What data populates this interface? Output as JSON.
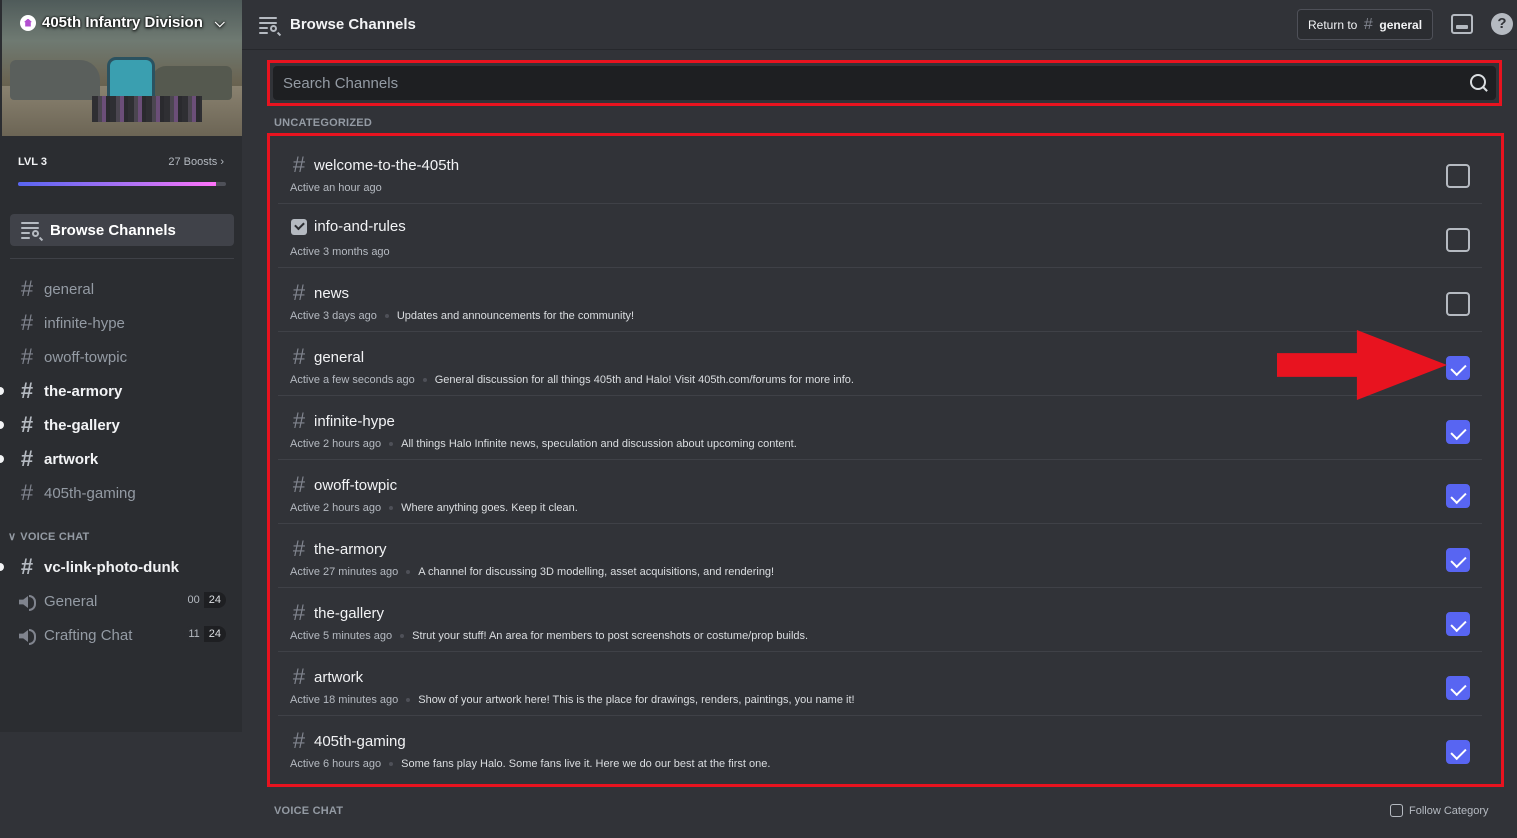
{
  "server": {
    "name": "405th Infantry Division",
    "level": "LVL 3",
    "boosts": "27 Boosts",
    "boost_progress": 0.95
  },
  "sidebar": {
    "browse_label": "Browse Channels",
    "channels": [
      {
        "name": "general",
        "unread": false
      },
      {
        "name": "infinite-hype",
        "unread": false
      },
      {
        "name": "owoff-towpic",
        "unread": false
      },
      {
        "name": "the-armory",
        "unread": true
      },
      {
        "name": "the-gallery",
        "unread": true
      },
      {
        "name": "artwork",
        "unread": true
      },
      {
        "name": "405th-gaming",
        "unread": false
      }
    ],
    "voice_category": "VOICE CHAT",
    "voice_text_channel": "vc-link-photo-dunk",
    "voice_channels": [
      {
        "name": "General",
        "count_a": "00",
        "count_b": "24"
      },
      {
        "name": "Crafting Chat",
        "count_a": "11",
        "count_b": "24"
      }
    ]
  },
  "header": {
    "title": "Browse Channels",
    "return_prefix": "Return to",
    "return_channel": "general",
    "help_glyph": "?"
  },
  "search": {
    "placeholder": "Search Channels",
    "value": ""
  },
  "categories": {
    "uncategorized": "UNCATEGORIZED",
    "voice": "VOICE CHAT",
    "follow_label": "Follow Category"
  },
  "channel_list": [
    {
      "name": "welcome-to-the-405th",
      "active": "Active an hour ago",
      "desc": "",
      "checked": false,
      "icon": "hash-icon"
    },
    {
      "name": "info-and-rules",
      "active": "Active 3 months ago",
      "desc": "",
      "checked": false,
      "icon": "rules-icon"
    },
    {
      "name": "news",
      "active": "Active 3 days ago",
      "desc": "Updates and announcements for the community!",
      "checked": false,
      "icon": "hash-icon"
    },
    {
      "name": "general",
      "active": "Active a few seconds ago",
      "desc": "General discussion for all things 405th and Halo! Visit 405th.com/forums for more info.",
      "checked": true,
      "icon": "hash-icon"
    },
    {
      "name": "infinite-hype",
      "active": "Active 2 hours ago",
      "desc": "All things Halo Infinite news, speculation and discussion about upcoming content.",
      "checked": true,
      "icon": "hash-icon"
    },
    {
      "name": "owoff-towpic",
      "active": "Active 2 hours ago",
      "desc": "Where anything goes. Keep it clean.",
      "checked": true,
      "icon": "hash-icon"
    },
    {
      "name": "the-armory",
      "active": "Active 27 minutes ago",
      "desc": "A channel for discussing 3D modelling, asset acquisitions, and rendering!",
      "checked": true,
      "icon": "hash-icon"
    },
    {
      "name": "the-gallery",
      "active": "Active 5 minutes ago",
      "desc": "Strut your stuff! An area for members to post screenshots or costume/prop builds.",
      "checked": true,
      "icon": "hash-icon"
    },
    {
      "name": "artwork",
      "active": "Active 18 minutes ago",
      "desc": "Show of your artwork here! This is the place for drawings, renders, paintings, you name it!",
      "checked": true,
      "icon": "hash-icon"
    },
    {
      "name": "405th-gaming",
      "active": "Active 6 hours ago",
      "desc": "Some fans play Halo. Some fans live it. Here we do our best at the first one.",
      "checked": true,
      "icon": "hash-icon"
    }
  ],
  "colors": {
    "accent": "#5865f2",
    "annotation_red": "#e8131f"
  }
}
